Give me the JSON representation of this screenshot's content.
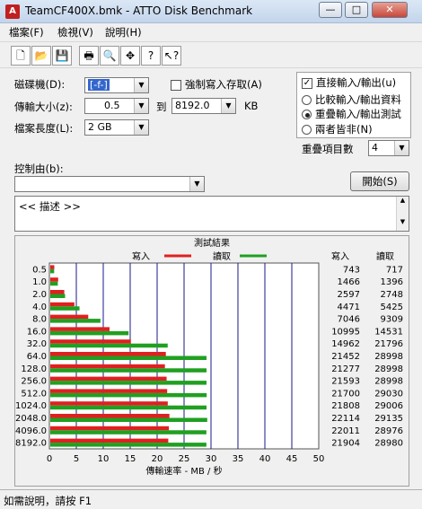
{
  "window": {
    "title": "TeamCF400X.bmk - ATTO Disk Benchmark",
    "app_icon": "atto-app-icon"
  },
  "menu": [
    "檔案(F)",
    "檢視(V)",
    "說明(H)"
  ],
  "toolbar": [
    "new-file-icon",
    "open-folder-icon",
    "save-icon",
    "print-icon",
    "print-preview-icon",
    "move-icon",
    "help-icon",
    "context-help-icon"
  ],
  "settings": {
    "drive_label": "磁碟機(D):",
    "drive_value": "[-f-]",
    "force_write_label": "強制寫入存取(A)",
    "force_write_checked": false,
    "direct_io_label": "直接輸入/輸出(u)",
    "direct_io_checked": true,
    "transfer_label": "傳輸大小(z):",
    "transfer_from": "0.5",
    "transfer_to_label": "到",
    "transfer_to": "8192.0",
    "transfer_unit": "KB",
    "length_label": "檔案長度(L):",
    "length_value": "2 GB",
    "io_options": [
      "比較輸入/輸出資料",
      "重疊輸入/輸出測試",
      "兩者皆非(N)"
    ],
    "io_selected": 1,
    "queue_label": "重疊項目數",
    "queue_value": "4",
    "control_label": "控制由(b):",
    "control_value": "",
    "start_button": "開始(S)",
    "description": "<<    描述    >>"
  },
  "results": {
    "title": "測試結果",
    "write_legend": "寫入",
    "read_legend": "讀取",
    "write_col": "寫入",
    "read_col": "讀取",
    "xlabel": "傳輸速率 - MB / 秒"
  },
  "chart_data": {
    "type": "bar",
    "orientation": "horizontal",
    "title": "測試結果",
    "xlabel": "傳輸速率 - MB / 秒",
    "xlim": [
      0,
      50
    ],
    "xticks": [
      0,
      5,
      10,
      15,
      20,
      25,
      30,
      35,
      40,
      45,
      50
    ],
    "categories": [
      "0.5",
      "1.0",
      "2.0",
      "4.0",
      "8.0",
      "16.0",
      "32.0",
      "64.0",
      "128.0",
      "256.0",
      "512.0",
      "1024.0",
      "2048.0",
      "4096.0",
      "8192.0"
    ],
    "series": [
      {
        "name": "寫入",
        "color": "#e02020",
        "values": [
          743,
          1466,
          2597,
          4471,
          7046,
          10995,
          14962,
          21452,
          21277,
          21593,
          21700,
          21808,
          22114,
          22011,
          21904
        ]
      },
      {
        "name": "讀取",
        "color": "#20a020",
        "values": [
          717,
          1396,
          2748,
          5425,
          9309,
          14531,
          21796,
          28998,
          28998,
          28998,
          29030,
          29006,
          29135,
          28976,
          28980
        ]
      }
    ],
    "legend": "top"
  },
  "status": {
    "text": "如需說明，請按 F1"
  },
  "colors": {
    "write": "#e02020",
    "read": "#20a020",
    "grid": "#1a1a8a"
  }
}
